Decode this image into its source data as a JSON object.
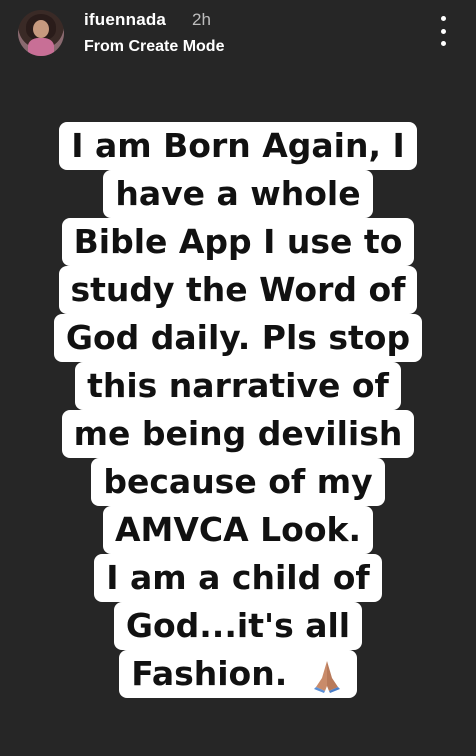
{
  "header": {
    "username": "ifuennada",
    "time": "2h",
    "subtitle": "From Create Mode",
    "more_icon": "more-vertical-icon"
  },
  "story": {
    "lines": [
      "I am Born Again, I",
      "have a whole",
      "Bible App I use to",
      "study the Word of",
      "God daily. Pls stop",
      "this narrative of",
      "me being devilish",
      "because of my",
      "AMVCA Look.",
      "I am a child of",
      "God...it's all",
      "Fashion."
    ],
    "emoji": "folded-hands-icon",
    "background": "#262626",
    "text_background": "#ffffff"
  }
}
